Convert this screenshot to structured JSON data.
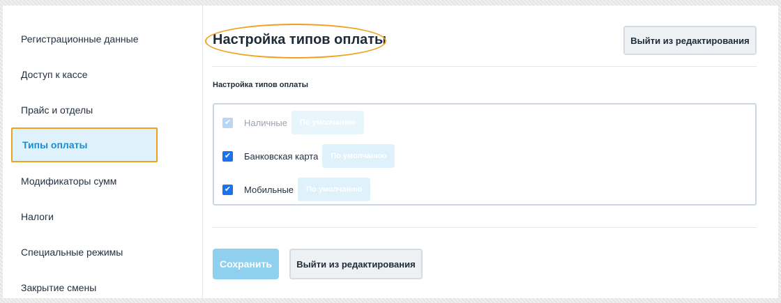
{
  "sidebar": {
    "items": [
      {
        "label": "Регистрационные данные"
      },
      {
        "label": "Доступ к кассе"
      },
      {
        "label": "Прайс и отделы"
      },
      {
        "label": "Типы оплаты"
      },
      {
        "label": "Модификаторы сумм"
      },
      {
        "label": "Налоги"
      },
      {
        "label": "Специальные режимы"
      },
      {
        "label": "Закрытие смены"
      }
    ]
  },
  "header": {
    "title": "Настройка типов оплаты",
    "exit_button": "Выйти из редактирования"
  },
  "section": {
    "label": "Настройка типов оплаты"
  },
  "payments": [
    {
      "label": "Наличные",
      "default_label": "По умолчанию",
      "checked": true,
      "disabled": true
    },
    {
      "label": "Банковская карта",
      "default_label": "По умолчанию",
      "checked": true,
      "disabled": false
    },
    {
      "label": "Мобильные",
      "default_label": "По умолчанию",
      "checked": true,
      "disabled": false
    }
  ],
  "footer": {
    "save_button": "Сохранить",
    "exit_button": "Выйти из редактирования"
  },
  "colors": {
    "accent": "#1c8ccd",
    "highlight": "#f0a11b",
    "active_bg": "#dff1fb",
    "checkbox": "#1a73e8",
    "save_bg": "#8fd0ee"
  }
}
